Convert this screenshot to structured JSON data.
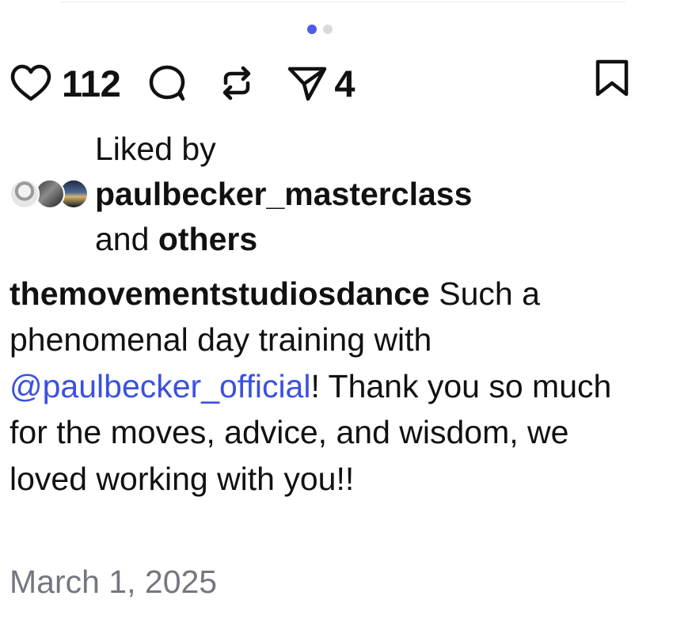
{
  "pager": {
    "total": 2,
    "active_index": 0
  },
  "actions": {
    "like_count": "112",
    "share_count": "4"
  },
  "liked_by": {
    "prefix": "Liked by",
    "user": "paulbecker_masterclass",
    "connector": "and",
    "others": "others",
    "avatars": [
      "avatar-1",
      "avatar-2",
      "avatar-3"
    ]
  },
  "caption": {
    "username": "themovementstudiosdance",
    "text_before_mention": " Such a phenomenal day training with ",
    "mention": "@paulbecker_official",
    "text_after_mention": "! Thank you so much for the moves, advice, and wisdom, we loved working with you!!"
  },
  "post": {
    "date": "March 1, 2025"
  },
  "icons": {
    "like": "heart-icon",
    "comment": "comment-icon",
    "repost": "repost-icon",
    "share": "send-icon",
    "bookmark": "bookmark-icon"
  },
  "colors": {
    "accent": "#4f5ce8",
    "mention": "#3b51e0",
    "muted": "#737780",
    "text": "#111111"
  }
}
